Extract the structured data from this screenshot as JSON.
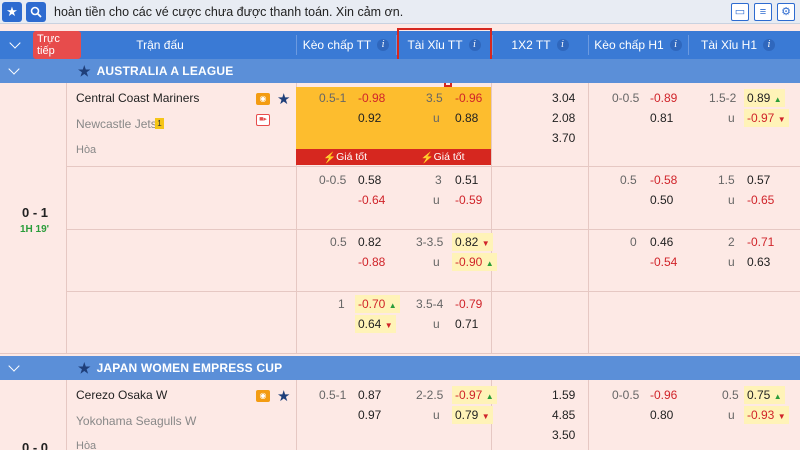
{
  "topbar": {
    "marquee": "hoàn tiền cho các vé cược chưa được thanh toán. Xin cảm ơn.",
    "icons": [
      "star-icon",
      "search-icon",
      "chat-icon",
      "document-icon",
      "settings-icon"
    ]
  },
  "header": {
    "live": "Trực tiếp",
    "match": "Trận đấu",
    "keo_tt": "Kèo chấp TT",
    "taixiu_tt": "Tài Xỉu TT",
    "x12_tt": "1X2 TT",
    "keo_h1": "Kèo chấp H1",
    "taixiu_h1": "Tài Xỉu H1",
    "info": "i"
  },
  "leagues": [
    {
      "name": "AUSTRALIA A LEAGUE",
      "match": {
        "home": "Central Coast Mariners",
        "away": "Newcastle Jets",
        "away_badge": "1",
        "draw": "Hòa",
        "score": "0 - 1",
        "time": "1H 19'",
        "best_label": "Giá tốt",
        "rows": [
          {
            "hdp_tt": [
              "0.5-1",
              "-0.98",
              "",
              "0.92"
            ],
            "ou_tt": [
              "3.5",
              "-0.96",
              "u",
              "0.88"
            ],
            "x12": [
              "3.04",
              "2.08",
              "3.70"
            ],
            "hdp_h1": [
              "0-0.5",
              "-0.89",
              "",
              "0.81"
            ],
            "ou_h1": [
              "1.5-2",
              "0.89",
              "u",
              "-0.97"
            ]
          },
          {
            "hdp_tt": [
              "0-0.5",
              "0.58",
              "",
              "-0.64"
            ],
            "ou_tt": [
              "3",
              "0.51",
              "u",
              "-0.59"
            ],
            "hdp_h1": [
              "0.5",
              "-0.58",
              "",
              "0.50"
            ],
            "ou_h1": [
              "1.5",
              "0.57",
              "u",
              "-0.65"
            ]
          },
          {
            "hdp_tt": [
              "0.5",
              "0.82",
              "",
              "-0.88"
            ],
            "ou_tt": [
              "3-3.5",
              "0.82",
              "u",
              "-0.90"
            ],
            "hdp_h1": [
              "0",
              "0.46",
              "",
              "-0.54"
            ],
            "ou_h1": [
              "2",
              "-0.71",
              "u",
              "0.63"
            ]
          },
          {
            "hdp_tt": [
              "1",
              "-0.70",
              "",
              "0.64"
            ],
            "ou_tt": [
              "3.5-4",
              "-0.79",
              "u",
              "0.71"
            ]
          }
        ]
      }
    },
    {
      "name": "JAPAN WOMEN EMPRESS CUP",
      "match": {
        "home": "Cerezo Osaka W",
        "away": "Yokohama Seagulls W",
        "draw": "Hòa",
        "score": "0 - 0",
        "rows": [
          {
            "hdp_tt": [
              "0.5-1",
              "0.87",
              "",
              "0.97"
            ],
            "ou_tt": [
              "2-2.5",
              "-0.97",
              "u",
              "0.79"
            ],
            "x12": [
              "1.59",
              "4.85",
              "3.50"
            ],
            "hdp_h1": [
              "0-0.5",
              "-0.96",
              "",
              "0.80"
            ],
            "ou_h1": [
              "0.5",
              "0.75",
              "u",
              "-0.93"
            ]
          }
        ]
      }
    }
  ]
}
